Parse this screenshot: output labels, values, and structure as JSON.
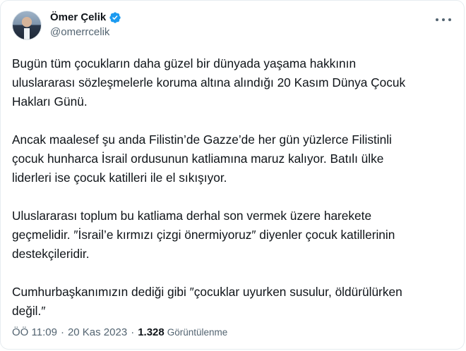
{
  "author": {
    "display_name": "Ömer Çelik",
    "handle": "@omerrcelik"
  },
  "tweet": {
    "paragraphs": [
      "Bugün tüm çocukların daha güzel bir dünyada yaşama hakkının\nuluslararası sözleşmelerle koruma altına alındığı 20 Kasım Dünya Çocuk\nHakları Günü.",
      "Ancak maalesef şu anda Filistin’de Gazze’de her gün yüzlerce Filistinli\nçocuk hunharca İsrail ordusunun katliamına maruz kalıyor. Batılı ülke\nliderleri ise çocuk katilleri ile el sıkışıyor.",
      "Uluslararası toplum bu katliama derhal son vermek üzere harekete\ngeçmelidir. ″İsrail’e kırmızı çizgi önermiyoruz″ diyenler çocuk katillerinin\ndestekçileridir.",
      "Cumhurbaşkanımızın dediği gibi ″çocuklar uyurken susulur, öldürülürken\ndeğil.″"
    ]
  },
  "meta": {
    "time": "ÖÖ 11:09",
    "separator": "·",
    "date": "20 Kas 2023",
    "views_count": "1.328",
    "views_label": "Görüntülenme"
  },
  "icons": {
    "verified": "verified-badge-icon",
    "more": "more-icon"
  },
  "colors": {
    "verified": "#1d9bf0",
    "text": "#0f1419",
    "secondary": "#536471"
  }
}
